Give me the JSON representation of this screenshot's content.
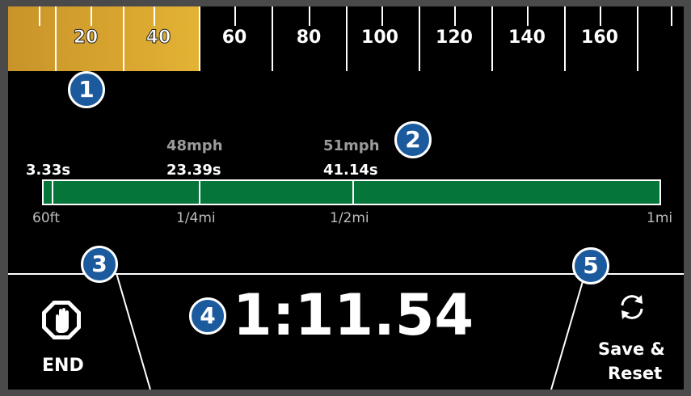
{
  "speed_scale": {
    "labels": [
      "20",
      "40",
      "60",
      "80",
      "100",
      "120",
      "140",
      "160"
    ],
    "fill_max_speed": 48
  },
  "callouts": [
    "1",
    "2",
    "3",
    "4",
    "5"
  ],
  "splits": [
    {
      "time": "3.33s",
      "speed": ""
    },
    {
      "time": "23.39s",
      "speed": "48mph"
    },
    {
      "time": "41.14s",
      "speed": "51mph"
    }
  ],
  "distance": {
    "labels": [
      "60ft",
      "1/4mi",
      "1/2mi",
      "1mi"
    ],
    "progress_fraction": 1.0
  },
  "timer": "1:11.54",
  "end_button": {
    "label": "END",
    "icon": "stop-hand-icon"
  },
  "reset_button": {
    "label_line1": "Save &",
    "label_line2": "Reset",
    "icon": "refresh-icon"
  },
  "colors": {
    "speed_fill": "#d9a52f",
    "progress_fill": "#06753a",
    "callout": "#1c5a9e",
    "background": "#000000"
  }
}
